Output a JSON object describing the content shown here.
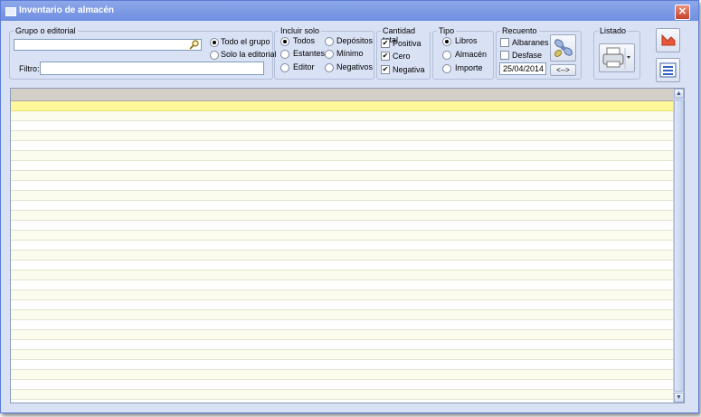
{
  "window": {
    "title": "Inventario de almacén"
  },
  "grupo": {
    "legend": "Grupo o editorial",
    "search_value": "",
    "filtro_label": "Filtro:",
    "filtro_value": "",
    "options": [
      {
        "label": "Todo el grupo",
        "selected": true
      },
      {
        "label": "Solo la editorial",
        "selected": false
      }
    ]
  },
  "incluir": {
    "legend": "Incluir solo",
    "options": [
      {
        "label": "Todos",
        "selected": true
      },
      {
        "label": "Depósitos",
        "selected": false
      },
      {
        "label": "Estantes",
        "selected": false
      },
      {
        "label": "Mínimo",
        "selected": false
      },
      {
        "label": "Editor",
        "selected": false
      },
      {
        "label": "Negativos",
        "selected": false
      }
    ]
  },
  "cantidad": {
    "legend": "Cantidad total",
    "options": [
      {
        "label": "Positiva",
        "checked": true
      },
      {
        "label": "Cero",
        "checked": true
      },
      {
        "label": "Negativa",
        "checked": true
      }
    ]
  },
  "tipo": {
    "legend": "Tipo",
    "options": [
      {
        "label": "Libros",
        "selected": true
      },
      {
        "label": "Almacén",
        "selected": false
      },
      {
        "label": "Importe",
        "selected": false
      }
    ]
  },
  "recuento": {
    "legend": "Recuento",
    "albaranes_label": "Albaranes",
    "albaranes_checked": false,
    "desfase_label": "Desfase",
    "desfase_checked": false,
    "date": "25/04/2014",
    "range_button": "<-->"
  },
  "listado": {
    "legend": "Listado"
  },
  "grid": {
    "row_count": 30,
    "selected_row": 0
  },
  "colors": {
    "selected_row": "#fff89a",
    "alt_row": "#fbfbee",
    "window_bg": "#d9e1f5"
  }
}
